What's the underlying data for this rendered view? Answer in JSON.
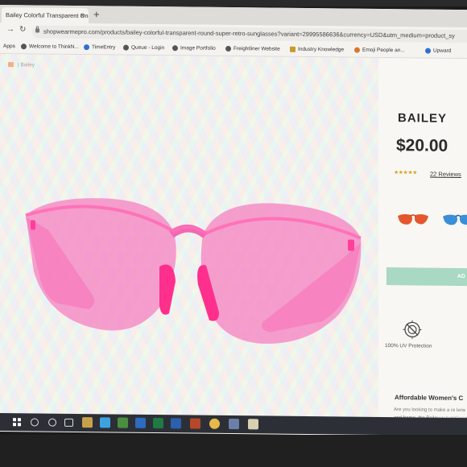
{
  "browser": {
    "tab_title": "Bailey Colorful Transparent One",
    "tab_close": "×",
    "new_tab": "+",
    "url": "shopwearmepro.com/products/bailey-colorful-transparent-round-super-retro-sunglasses?variant=29995586636&currency=USD&utm_medium=product_sy"
  },
  "bookmarks": [
    {
      "label": "Apps"
    },
    {
      "label": "Welcome to ThinkN..."
    },
    {
      "label": "TimeEntry"
    },
    {
      "label": "Queue - Login"
    },
    {
      "label": "Image Portfolio"
    },
    {
      "label": "Freightliner Website"
    },
    {
      "label": "Industry Knowledge"
    },
    {
      "label": "Emoji People an..."
    },
    {
      "label": "Upward"
    }
  ],
  "breadcrumb": {
    "current": "Bailey"
  },
  "product": {
    "title": "BAILEY",
    "price": "$20.00",
    "stars": "★★★★★",
    "rating_fraction": 1.0,
    "reviews": "22 Reviews",
    "add_button": "AD",
    "uv_label": "100% UV Protection",
    "section_heading": "Affordable Women's C",
    "description": "Are you looking to make a re lens and frame, the Bailey w sunglasses that will become resistant and bound to last yo"
  },
  "colors": {
    "lens": "#f58ac4",
    "frame": "#ff3f99",
    "swatch_red": "#e4572e",
    "swatch_blue": "#3a8fd8",
    "add_button": "#a9d8c3"
  }
}
